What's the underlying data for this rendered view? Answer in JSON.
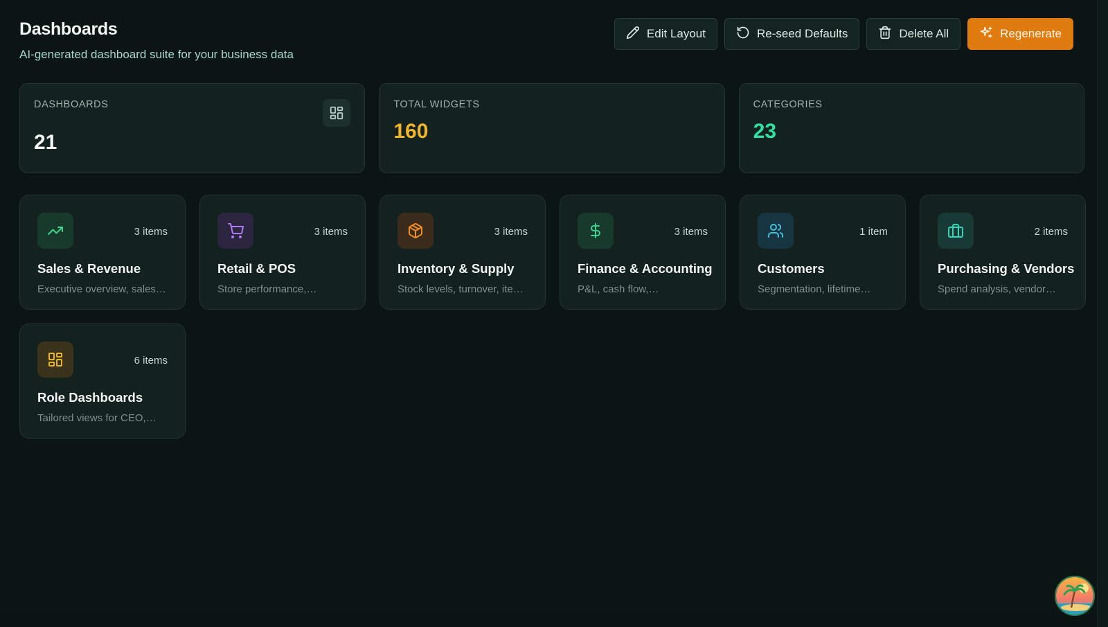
{
  "header": {
    "title": "Dashboards",
    "subtitle": "AI-generated dashboard suite for your business data"
  },
  "actions": {
    "edit_layout": "Edit Layout",
    "reseed_defaults": "Re-seed Defaults",
    "delete_all": "Delete All",
    "regenerate": "Regenerate"
  },
  "stats": [
    {
      "label": "DASHBOARDS",
      "value": "21",
      "color": "#f4f7f6",
      "icon": "grid-icon"
    },
    {
      "label": "TOTAL WIDGETS",
      "value": "160",
      "color": "#f1b52a"
    },
    {
      "label": "CATEGORIES",
      "value": "23",
      "color": "#2fe3a2"
    }
  ],
  "categories": [
    {
      "title": "Sales & Revenue",
      "count": "3 items",
      "desc": "Executive overview, sales…",
      "icon": "trending-up-icon",
      "color": "#3ed38c",
      "bg": "#173a2c"
    },
    {
      "title": "Retail & POS",
      "count": "3 items",
      "desc": "Store performance,…",
      "icon": "shopping-cart-icon",
      "color": "#b07cf2",
      "bg": "#2b2540"
    },
    {
      "title": "Inventory & Supply",
      "count": "3 items",
      "desc": "Stock levels, turnover, ite…",
      "icon": "package-icon",
      "color": "#f08c28",
      "bg": "#3a2b1a"
    },
    {
      "title": "Finance & Accounting",
      "count": "3 items",
      "desc": "P&L, cash flow,…",
      "icon": "dollar-icon",
      "color": "#3ed38c",
      "bg": "#173a2c"
    },
    {
      "title": "Customers",
      "count": "1 item",
      "desc": "Segmentation, lifetime…",
      "icon": "users-icon",
      "color": "#3fc0df",
      "bg": "#173540"
    },
    {
      "title": "Purchasing & Vendors",
      "count": "2 items",
      "desc": "Spend analysis, vendor…",
      "icon": "briefcase-icon",
      "color": "#2fd6b8",
      "bg": "#173a36"
    },
    {
      "title": "Role Dashboards",
      "count": "6 items",
      "desc": "Tailored views for CEO,…",
      "icon": "layout-icon",
      "color": "#e9b525",
      "bg": "#3a321a"
    }
  ]
}
